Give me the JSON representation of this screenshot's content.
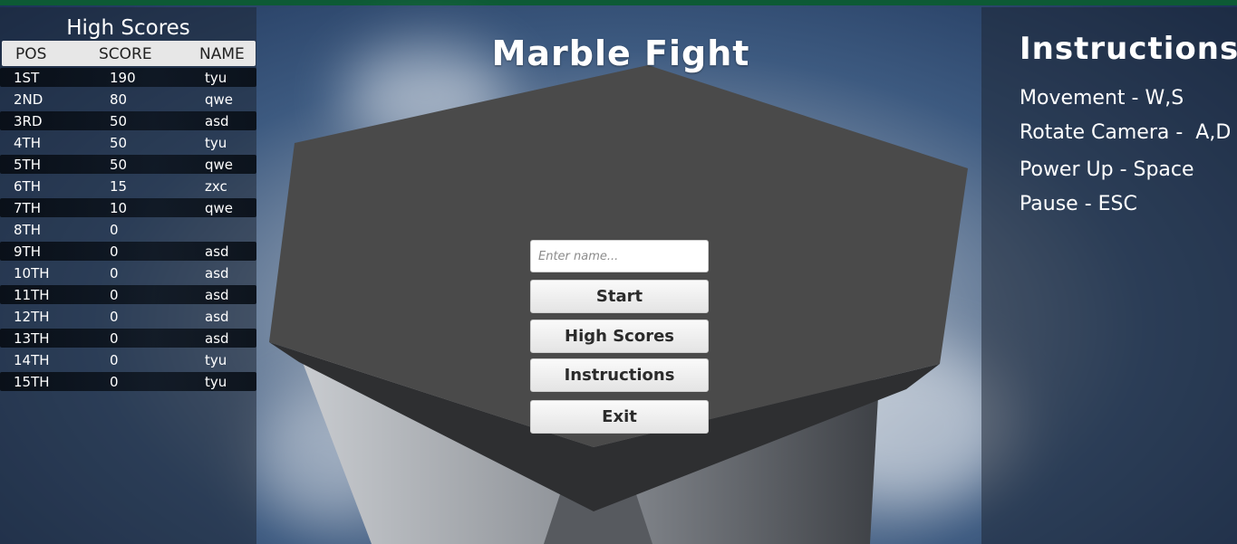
{
  "title": "Marble Fight",
  "high_scores": {
    "title": "High Scores",
    "headers": {
      "pos": "POS",
      "score": "SCORE",
      "name": "NAME"
    },
    "rows": [
      {
        "pos": "1ST",
        "score": "190",
        "name": "tyu"
      },
      {
        "pos": "2ND",
        "score": "80",
        "name": "qwe"
      },
      {
        "pos": "3RD",
        "score": "50",
        "name": "asd"
      },
      {
        "pos": "4TH",
        "score": "50",
        "name": "tyu"
      },
      {
        "pos": "5TH",
        "score": "50",
        "name": "qwe"
      },
      {
        "pos": "6TH",
        "score": "15",
        "name": "zxc"
      },
      {
        "pos": "7TH",
        "score": "10",
        "name": "qwe"
      },
      {
        "pos": "8TH",
        "score": "0",
        "name": ""
      },
      {
        "pos": "9TH",
        "score": "0",
        "name": "asd"
      },
      {
        "pos": "10TH",
        "score": "0",
        "name": "asd"
      },
      {
        "pos": "11TH",
        "score": "0",
        "name": "asd"
      },
      {
        "pos": "12TH",
        "score": "0",
        "name": "asd"
      },
      {
        "pos": "13TH",
        "score": "0",
        "name": "asd"
      },
      {
        "pos": "14TH",
        "score": "0",
        "name": "tyu"
      },
      {
        "pos": "15TH",
        "score": "0",
        "name": "tyu"
      }
    ]
  },
  "menu": {
    "name_placeholder": "Enter name...",
    "start": "Start",
    "high_scores": "High Scores",
    "instructions": "Instructions",
    "exit": "Exit"
  },
  "instructions": {
    "title": "Instructions",
    "movement": "Movement - W,S",
    "rotate": "Rotate Camera -  A,D",
    "power_up": "Power Up - Space",
    "pause": "Pause - ESC"
  }
}
